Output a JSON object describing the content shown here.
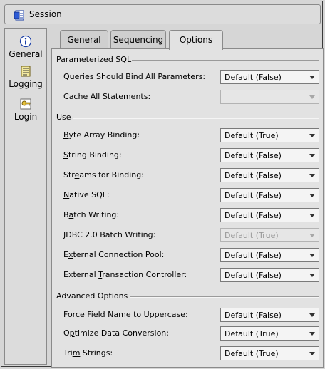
{
  "window": {
    "title": "Session",
    "icon": "session-icon"
  },
  "sidebar": {
    "items": [
      {
        "label": "General",
        "icon": "info-icon"
      },
      {
        "label": "Logging",
        "icon": "logging-icon"
      },
      {
        "label": "Login",
        "icon": "login-key-icon"
      }
    ]
  },
  "tabs": [
    {
      "label": "General"
    },
    {
      "label": "Sequencing"
    },
    {
      "label": "Options",
      "selected": true
    }
  ],
  "sections": {
    "parameterized_sql": {
      "title": "Parameterized SQL",
      "rows": [
        {
          "mnemonic": "Q",
          "rest": "ueries Should Bind All Parameters:",
          "value": "Default (False)",
          "enabled": true
        },
        {
          "mnemonic": "C",
          "rest": "ache All Statements:",
          "value": "",
          "enabled": false
        }
      ]
    },
    "use": {
      "title": "Use",
      "rows": [
        {
          "mnemonic": "B",
          "rest": "yte Array Binding:",
          "value": "Default (True)",
          "enabled": true
        },
        {
          "mnemonic": "S",
          "rest": "tring Binding:",
          "value": "Default (False)",
          "enabled": true
        },
        {
          "pre": "Str",
          "mnemonic": "e",
          "rest": "ams for Binding:",
          "value": "Default (False)",
          "enabled": true
        },
        {
          "mnemonic": "N",
          "rest": "ative SQL:",
          "value": "Default (False)",
          "enabled": true
        },
        {
          "pre": "B",
          "mnemonic": "a",
          "rest": "tch Writing:",
          "value": "Default (False)",
          "enabled": true
        },
        {
          "mnemonic": "J",
          "rest": "DBC 2.0 Batch Writing:",
          "value": "Default (True)",
          "enabled": false
        },
        {
          "pre": "E",
          "mnemonic": "x",
          "rest": "ternal Connection Pool:",
          "value": "Default (False)",
          "enabled": true
        },
        {
          "pre": "External ",
          "mnemonic": "T",
          "rest": "ransaction Controller:",
          "value": "Default (False)",
          "enabled": true
        }
      ]
    },
    "advanced": {
      "title": "Advanced Options",
      "rows": [
        {
          "mnemonic": "F",
          "rest": "orce Field Name to Uppercase:",
          "value": "Default (False)",
          "enabled": true
        },
        {
          "pre": "O",
          "mnemonic": "p",
          "rest": "timize Data Conversion:",
          "value": "Default (True)",
          "enabled": true
        },
        {
          "pre": "Tri",
          "mnemonic": "m",
          "rest": " Strings:",
          "value": "Default (True)",
          "enabled": true
        }
      ]
    }
  }
}
